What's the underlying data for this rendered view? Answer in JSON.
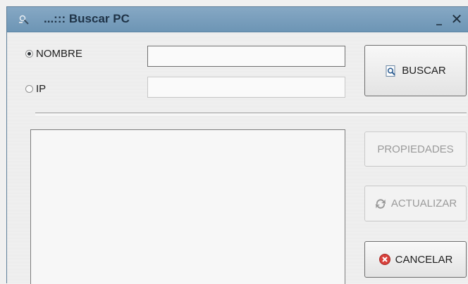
{
  "window": {
    "title": "...::: Buscar PC",
    "minimize": "_",
    "close": "✕"
  },
  "search": {
    "options": [
      {
        "label": "NOMBRE",
        "selected": true
      },
      {
        "label": "IP",
        "selected": false
      }
    ],
    "nombre_value": "",
    "ip_value": ""
  },
  "buttons": {
    "buscar": "BUSCAR",
    "propiedades": "PROPIEDADES",
    "actualizar": "ACTUALIZAR",
    "cancelar": "CANCELAR"
  },
  "icons": {
    "title": "magnifier-tools-icon",
    "buscar": "search-document-icon",
    "actualizar": "refresh-icon",
    "cancelar": "cancel-icon"
  },
  "colors": {
    "titlebar": "#7aa0be",
    "cancel_icon": "#d9413c"
  }
}
